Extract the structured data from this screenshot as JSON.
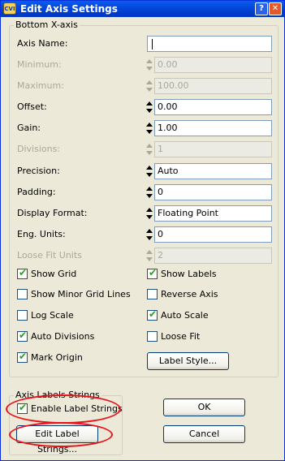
{
  "window": {
    "title": "Edit Axis Settings",
    "app_icon_text": "CVI",
    "help_glyph": "?",
    "close_glyph": "✕"
  },
  "group_axis": {
    "title": "Bottom X-axis"
  },
  "fields": [
    {
      "label": "Axis Name:",
      "value": "",
      "enabled": true
    },
    {
      "label": "Minimum:",
      "value": "0.00",
      "enabled": false
    },
    {
      "label": "Maximum:",
      "value": "100.00",
      "enabled": false
    },
    {
      "label": "Offset:",
      "value": "0.00",
      "enabled": true
    },
    {
      "label": "Gain:",
      "value": "1.00",
      "enabled": true
    },
    {
      "label": "Divisions:",
      "value": "1",
      "enabled": false
    },
    {
      "label": "Precision:",
      "value": "Auto",
      "enabled": true
    },
    {
      "label": "Padding:",
      "value": "0",
      "enabled": true
    },
    {
      "label": "Display Format:",
      "value": "Floating Point",
      "enabled": true
    },
    {
      "label": "Eng. Units:",
      "value": "0",
      "enabled": true
    },
    {
      "label": "Loose Fit Units",
      "value": "2",
      "enabled": false
    }
  ],
  "checkboxes_left": [
    {
      "label": "Show Grid",
      "checked": true
    },
    {
      "label": "Show Minor Grid Lines",
      "checked": false
    },
    {
      "label": "Log Scale",
      "checked": false
    },
    {
      "label": "Auto Divisions",
      "checked": true
    },
    {
      "label": "Mark Origin",
      "checked": true
    }
  ],
  "checkboxes_right": [
    {
      "label": "Show Labels",
      "checked": true
    },
    {
      "label": "Reverse Axis",
      "checked": false
    },
    {
      "label": "Auto Scale",
      "checked": true
    },
    {
      "label": "Loose Fit",
      "checked": false
    }
  ],
  "buttons": {
    "label_style": "Label Style...",
    "ok": "OK",
    "cancel": "Cancel",
    "edit_label_strings": "Edit Label Strings..."
  },
  "group_labels": {
    "title": "Axis Labels Strings",
    "enable_label": "Enable Label Strings",
    "enable_checked": true
  },
  "check_glyph": "✔",
  "colors": {
    "title_bar": "#0A5BEE",
    "dialog_bg": "#ECE9D8",
    "highlight_circle": "#E8131A",
    "check": "#21A121"
  }
}
